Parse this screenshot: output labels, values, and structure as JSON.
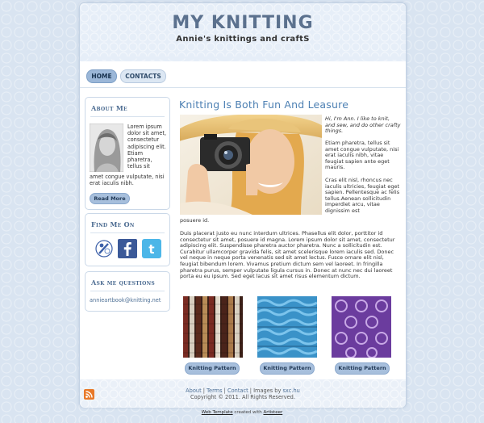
{
  "header": {
    "title": "MY KNITTING",
    "subtitle": "Annie's knittings and craftS"
  },
  "nav": [
    {
      "label": "HOME",
      "active": true
    },
    {
      "label": "CONTACTS",
      "active": false
    }
  ],
  "sidebar": {
    "about": {
      "title": "About Me",
      "text_side": "Lorem ipsum dolor sit amet, consectetur adipiscing elit. Etiam pharetra, tellus sit",
      "text_below": "amet congue vulputate, nisi erat iaculis nibh.",
      "button": "Read More"
    },
    "find": {
      "title": "Find Me On",
      "icons": [
        "messenger-icon",
        "facebook-icon",
        "twitter-icon"
      ]
    },
    "ask": {
      "title": "Ask me questions",
      "email": "annieartbook@knitting.net"
    }
  },
  "main": {
    "title": "Knitting Is Both Fun And Leasure",
    "intro_italic": "Hi, I'm Ann. I like to knit, and sew, and do other crafty things.",
    "para1": "Etiam pharetra, tellus sit amet congue vulputate, nisi erat iaculis nibh, vitae feugiat sapien ante eget mauris.",
    "para2": "Cras elit nisl, rhoncus nec iaculis ultricies, feugiat eget sapien. Pellentesque ac felis tellus.Aenean sollicitudin imperdiet arcu, vitae dignissim est",
    "para2_end": "posuere id.",
    "para3": "Duis placerat justo eu nunc interdum ultrices. Phasellus elit dolor, porttitor id consectetur sit amet, posuere id magna. Lorem ipsum dolor sit amet, consectetur adipiscing elit. Suspendisse pharetra auctor pharetra. Nunc a sollicitudin est. Curabitur ullamcorper gravida felis, sit amet scelerisque lorem iaculis sed. Donec vel neque in neque porta venenatis sed sit amet lectus. Fusce ornare elit nisl, feugiat bibendum lorem. Vivamus pretium dictum sem vel laoreet. In fringilla pharetra purus, semper vulputate ligula cursus in. Donec at nunc nec dui laoreet porta eu eu ipsum. Sed eget lacus sit amet risus elementum dictum.",
    "patterns": [
      {
        "label": "Knitting Pattern"
      },
      {
        "label": "Knitting Pattern"
      },
      {
        "label": "Knitting Pattern"
      }
    ]
  },
  "footer": {
    "links": [
      "About",
      "Terms",
      "Contact"
    ],
    "separator": "|",
    "images_by_label": "Images by",
    "images_by_link": "sxc.hu",
    "copyright": "Copyright © 2011. All Rights Reserved.",
    "rss_icon": "rss-icon"
  },
  "credit": {
    "link": "Web Template",
    "mid": "created with",
    "tool": "Artisteer"
  },
  "colors": {
    "accent": "#4d80b3",
    "title": "#5b718e",
    "button": "#a7bfdc",
    "background": "#d9e4f1"
  }
}
